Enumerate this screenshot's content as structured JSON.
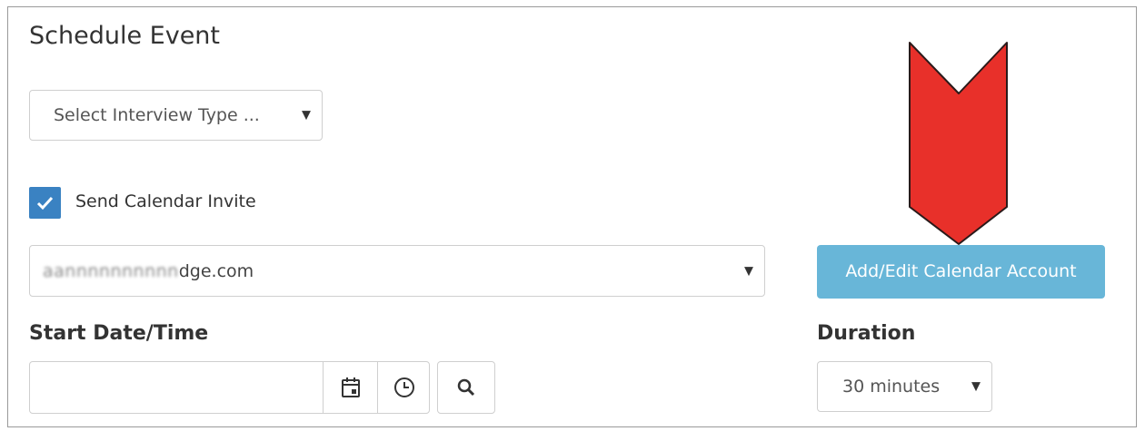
{
  "form": {
    "title": "Schedule Event",
    "interview_type": {
      "selected": "Select Interview Type ...",
      "caret": "▼"
    },
    "send_invite": {
      "label": "Send Calendar Invite",
      "checked": true
    },
    "calendar_account": {
      "value_obscured": "aannnnnnnnnn",
      "value_suffix": "dge.com",
      "caret": "▼"
    },
    "add_edit_button": {
      "label": "Add/Edit Calendar Account"
    },
    "start_datetime": {
      "label": "Start Date/Time",
      "value": ""
    },
    "duration": {
      "label": "Duration",
      "selected": "30 minutes",
      "caret": "▼"
    }
  },
  "colors": {
    "checkbox": "#3a82c2",
    "button": "#68b6d8",
    "annotation_arrow": "#e8302a"
  },
  "icons": [
    "calendar-icon",
    "clock-icon",
    "search-icon",
    "checkmark-icon",
    "annotation-arrow"
  ]
}
